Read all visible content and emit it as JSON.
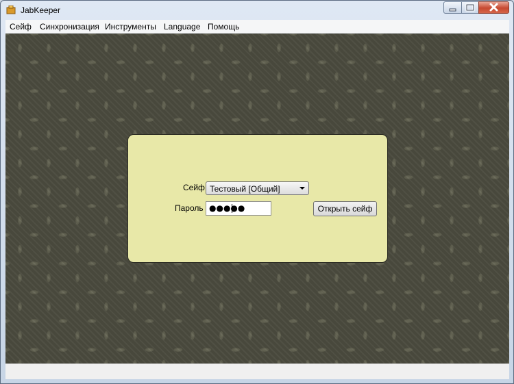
{
  "window": {
    "title": "JabKeeper",
    "icons": {
      "app": "jabkeeper-app-icon",
      "minimize": "minimize-icon",
      "maximize": "maximize-icon",
      "close": "close-icon"
    },
    "colors": {
      "panel": "#e8e8a8",
      "close_button": "#c74a31"
    }
  },
  "menu": {
    "items": [
      {
        "label": "Сейф"
      },
      {
        "label": "Синхронизация"
      },
      {
        "label": "Инструменты"
      },
      {
        "label": "Language"
      },
      {
        "label": "Помощь"
      }
    ]
  },
  "login": {
    "safe_label": "Сейф",
    "safe_selected": "Тестовый [Общий]",
    "password_label": "Пароль",
    "password_value": "●●●●●",
    "open_button": "Открыть сейф"
  }
}
